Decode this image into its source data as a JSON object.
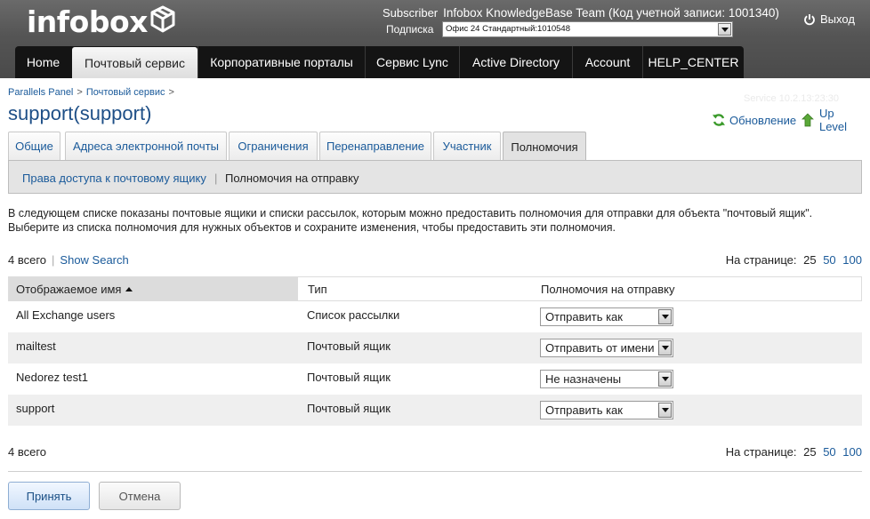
{
  "header": {
    "logo_text": "infobox",
    "subscriber_label": "Subscriber",
    "subscriber_value": "Infobox KnowledgeBase Team (Код учетной записи: 1001340)",
    "subscription_label": "Подписка",
    "subscription_value": "Офис 24 Стандартный:1010548",
    "exit_label": "Выход"
  },
  "nav": {
    "tabs": [
      {
        "label": "Home"
      },
      {
        "label": "Почтовый сервис"
      },
      {
        "label": "Корпоративные порталы"
      },
      {
        "label": "Сервис Lync"
      },
      {
        "label": "Active Directory"
      },
      {
        "label": "Account"
      },
      {
        "label": "HELP_CENTER"
      }
    ],
    "active": "Почтовый сервис"
  },
  "breadcrumb": [
    {
      "label": "Parallels Panel"
    },
    {
      "label": "Почтовый сервис"
    }
  ],
  "page": {
    "title": "support(support)",
    "faint_text": "Service 10.2.13:23:30",
    "refresh_label": "Обновление",
    "uplevel_label": "Up Level"
  },
  "tabs": [
    {
      "label": "Общие"
    },
    {
      "label": "Адреса электронной почты"
    },
    {
      "label": "Ограничения"
    },
    {
      "label": "Перенаправление"
    },
    {
      "label": "Участник"
    },
    {
      "label": "Полномочия"
    }
  ],
  "active_tab": "Полномочия",
  "subtabs": [
    {
      "label": "Права доступа к почтовому ящику"
    },
    {
      "label": "Полномочия на отправку"
    }
  ],
  "description": [
    "В следующем списке показаны почтовые ящики и списки рассылок, которым можно предоставить полномочия для отправки для объекта \"почтовый ящик\".",
    "Выберите из списка полномочия для нужных объектов и сохраните изменения, чтобы предоставить эти полномочия."
  ],
  "grid": {
    "total_text": "4 всего",
    "show_search": "Show Search",
    "per_page_label": "На странице:",
    "per_page_options": [
      "25",
      "50",
      "100"
    ],
    "columns": [
      "Отображаемое имя",
      "Тип",
      "Полномочия на отправку"
    ],
    "rows": [
      {
        "name": "All Exchange users",
        "type": "Список рассылки",
        "permission": "Отправить как"
      },
      {
        "name": "mailtest",
        "type": "Почтовый ящик",
        "permission": "Отправить от имени"
      },
      {
        "name": "Nedorez test1",
        "type": "Почтовый ящик",
        "permission": "Не назначены"
      },
      {
        "name": "support",
        "type": "Почтовый ящик",
        "permission": "Отправить как"
      }
    ]
  },
  "buttons": {
    "accept": "Принять",
    "cancel": "Отмена"
  },
  "colors": {
    "link": "#1a5a9a",
    "header_bg": "#555555",
    "nav_bg": "#141414"
  }
}
